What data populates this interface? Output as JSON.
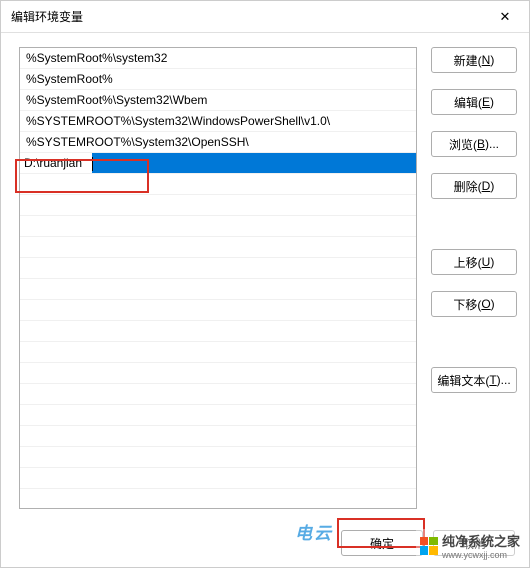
{
  "dialog": {
    "title": "编辑环境变量",
    "close_icon": "✕"
  },
  "list": {
    "items": [
      "%SystemRoot%\\system32",
      "%SystemRoot%",
      "%SystemRoot%\\System32\\Wbem",
      "%SYSTEMROOT%\\System32\\WindowsPowerShell\\v1.0\\",
      "%SYSTEMROOT%\\System32\\OpenSSH\\"
    ],
    "editing_value": "D:\\ruanjian"
  },
  "buttons": {
    "new": {
      "label": "新建(",
      "mnemonic": "N",
      "suffix": ")"
    },
    "edit": {
      "label": "编辑(",
      "mnemonic": "E",
      "suffix": ")"
    },
    "browse": {
      "label": "浏览(",
      "mnemonic": "B",
      "suffix": ")..."
    },
    "delete": {
      "label": "删除(",
      "mnemonic": "D",
      "suffix": ")"
    },
    "moveup": {
      "label": "上移(",
      "mnemonic": "U",
      "suffix": ")"
    },
    "movedown": {
      "label": "下移(",
      "mnemonic": "O",
      "suffix": ")"
    },
    "edittext": {
      "label": "编辑文本(",
      "mnemonic": "T",
      "suffix": ")..."
    }
  },
  "footer": {
    "ok": "确定",
    "cancel": "取消"
  },
  "watermark": {
    "left_text": "电云",
    "right_text": "纯净系统之家",
    "right_url": "www.ycwxjj.com"
  }
}
